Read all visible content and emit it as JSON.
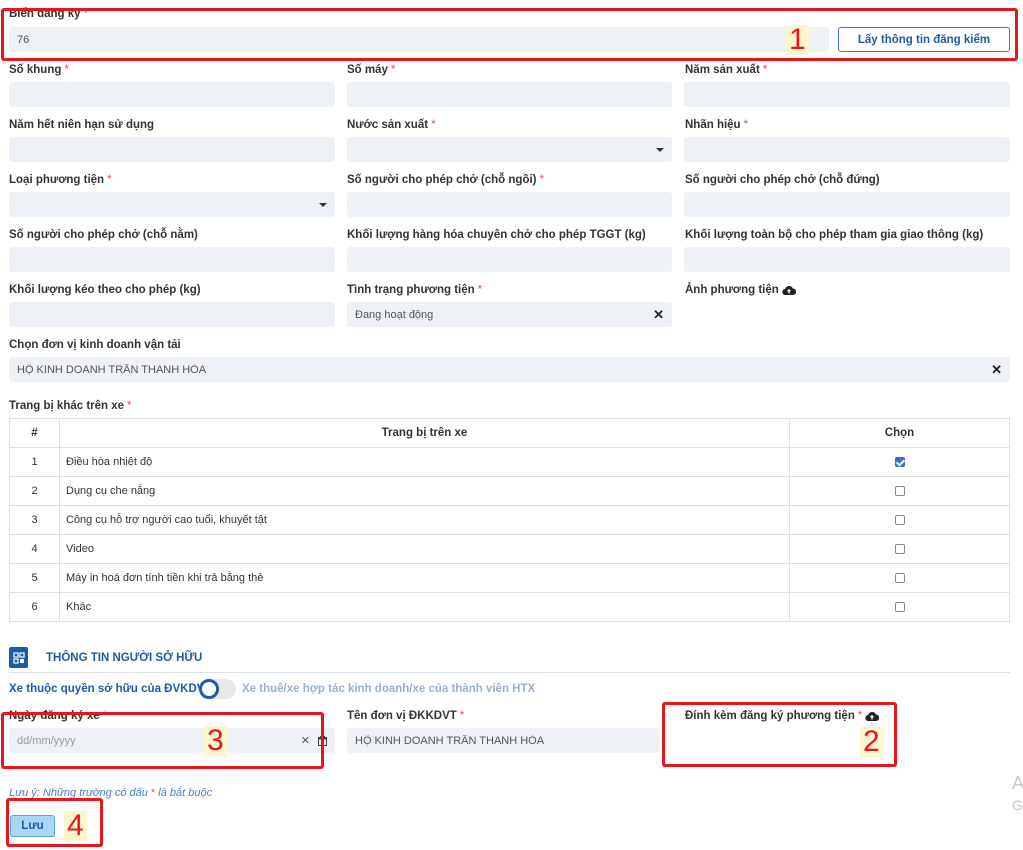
{
  "plate": {
    "label": "Biển đăng ký",
    "value": "76",
    "fetch_button": "Lấy thông tin đăng kiểm"
  },
  "fields": {
    "chassis": {
      "label": "Số khung",
      "value": ""
    },
    "engine": {
      "label": "Số máy",
      "value": ""
    },
    "mfg_year": {
      "label": "Năm sản xuất",
      "value": ""
    },
    "expiry_year": {
      "label": "Năm hết niên hạn sử dụng",
      "value": ""
    },
    "country": {
      "label": "Nước sản xuất",
      "value": ""
    },
    "brand": {
      "label": "Nhãn hiệu",
      "value": ""
    },
    "vehicle_type": {
      "label": "Loại phương tiện",
      "value": ""
    },
    "seats_sitting": {
      "label": "Số người cho phép chở (chỗ ngồi)",
      "value": ""
    },
    "seats_standing": {
      "label": "Số người cho phép chở (chỗ đứng)",
      "value": ""
    },
    "seats_lying": {
      "label": "Số người cho phép chở (chỗ nằm)",
      "value": ""
    },
    "cargo_weight": {
      "label": "Khối lượng hàng hóa chuyên chở cho phép TGGT (kg)",
      "value": ""
    },
    "total_weight": {
      "label": "Khối lượng toàn bộ cho phép tham gia giao thông (kg)",
      "value": ""
    },
    "tow_weight": {
      "label": "Khối lượng kéo theo cho phép (kg)",
      "value": ""
    },
    "status": {
      "label": "Tình trạng phương tiện",
      "value": "Đang hoạt động"
    },
    "photo": {
      "label": "Ảnh phương tiện"
    },
    "business_unit": {
      "label": "Chọn đơn vị kinh doanh vận tải",
      "value": "HỘ KINH DOANH TRẦN THANH HÒA"
    }
  },
  "equipment": {
    "label": "Trang bị khác trên xe",
    "headers": [
      "#",
      "Trang bị trên xe",
      "Chọn"
    ],
    "rows": [
      {
        "no": "1",
        "name": "Điều hòa nhiệt độ",
        "checked": true
      },
      {
        "no": "2",
        "name": "Dụng cụ che nắng",
        "checked": false
      },
      {
        "no": "3",
        "name": "Công cụ hỗ trợ người cao tuổi, khuyết tật",
        "checked": false
      },
      {
        "no": "4",
        "name": "Video",
        "checked": false
      },
      {
        "no": "5",
        "name": "Máy in hoá đơn tính tiền khi trả bằng thẻ",
        "checked": false
      },
      {
        "no": "6",
        "name": "Khác",
        "checked": false
      }
    ]
  },
  "owner": {
    "section_title": "THÔNG TIN NGƯỜI SỞ HỮU",
    "toggle_left": "Xe thuộc quyền sở hữu của ĐVKDVT",
    "toggle_right": "Xe thuê/xe hợp tác kinh doanh/xe của thành viên HTX",
    "reg_date_label": "Ngày đăng ký xe",
    "reg_date_placeholder": "dd/mm/yyyy",
    "unit_name_label": "Tên đơn vị ĐKKDVT",
    "unit_name_value": "HỘ KINH DOANH TRẦN THANH HÒA",
    "attach_label": "Đính kèm đăng ký phương tiện"
  },
  "note": {
    "prefix": "Lưu ý: Những trường có dấu ",
    "star": "*",
    "suffix": " là bắt buộc"
  },
  "save_button": "Lưu",
  "watermark": [
    "A",
    "G"
  ],
  "annotations": [
    "1",
    "2",
    "3",
    "4"
  ],
  "required_mark": "*",
  "clear_mark": "✕",
  "colors": {
    "accent": "#1f5aa8",
    "annotation": "#e8141e",
    "field_bg": "#eef1f5",
    "save_bg": "#a9d8f7"
  }
}
